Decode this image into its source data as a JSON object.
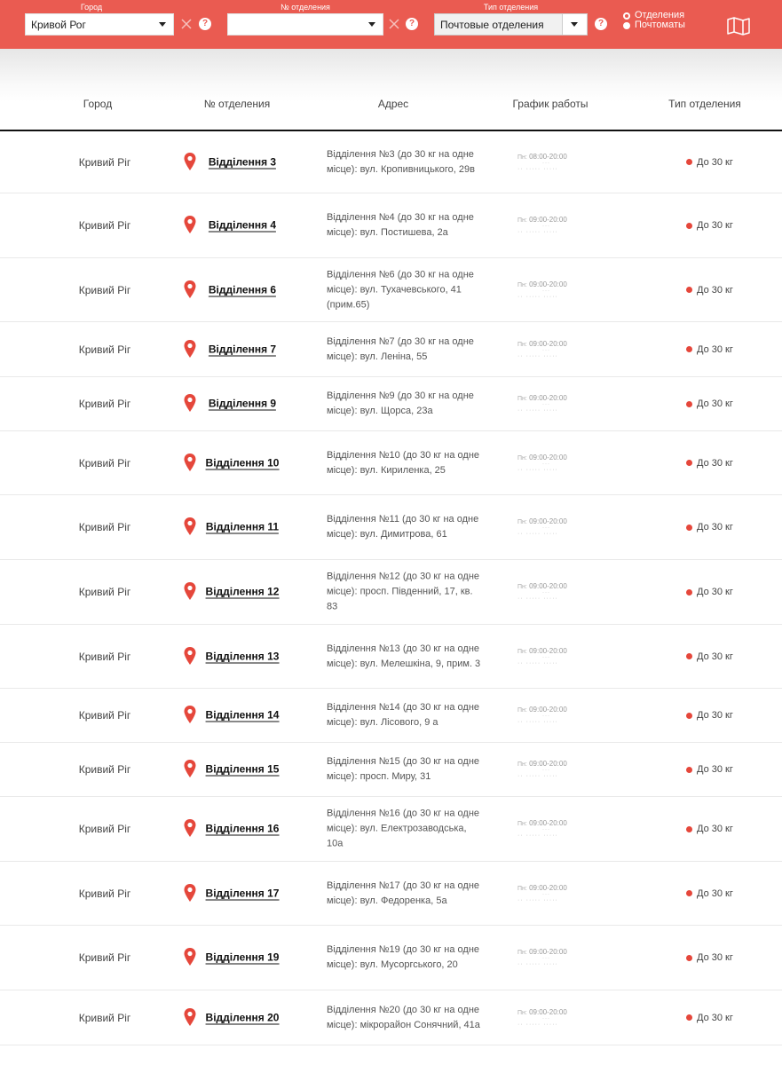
{
  "colors": {
    "accent": "#ea5b51",
    "pin": "#e5473b"
  },
  "filters": {
    "city_label": "Город",
    "city_value": "Кривой Рог",
    "branch_label": "№ отделения",
    "branch_value": "",
    "type_label": "Тип отделения",
    "type_value": "Почтовые отделения",
    "help": "?",
    "radio_branches": "Отделения",
    "radio_lockers": "Почтоматы",
    "selected_radio": "Отделения"
  },
  "table": {
    "headers": {
      "city": "Город",
      "branch": "№ отделения",
      "address": "Адрес",
      "schedule": "График работы",
      "type": "Тип отделения"
    },
    "rows": [
      {
        "city": "Кривий Ріг",
        "branch": "Відділення 3",
        "address": "Відділення №3 (до 30 кг на одне місце): вул. Кропивницького, 29в",
        "day": "Пн:",
        "hours": "08:00-20:00",
        "type": "До 30 кг"
      },
      {
        "city": "Кривий Ріг",
        "branch": "Відділення 4",
        "address": "Відділення №4 (до 30 кг на одне місце): вул. Постишева, 2а",
        "day": "Пн:",
        "hours": "09:00-20:00",
        "type": "До 30 кг"
      },
      {
        "city": "Кривий Ріг",
        "branch": "Відділення 6",
        "address": "Відділення №6 (до 30 кг на одне місце): вул. Тухачевського, 41 (прим.65)",
        "day": "Пн:",
        "hours": "09:00-20:00",
        "type": "До 30 кг"
      },
      {
        "city": "Кривий Ріг",
        "branch": "Відділення 7",
        "address": "Відділення №7 (до 30 кг на одне місце): вул. Леніна, 55",
        "day": "Пн:",
        "hours": "09:00-20:00",
        "type": "До 30 кг"
      },
      {
        "city": "Кривий Ріг",
        "branch": "Відділення 9",
        "address": "Відділення №9 (до 30 кг на одне місце): вул. Щорса, 23а",
        "day": "Пн:",
        "hours": "09:00-20:00",
        "type": "До 30 кг"
      },
      {
        "city": "Кривий Ріг",
        "branch": "Відділення 10",
        "address": "Відділення №10 (до 30 кг на одне місце): вул. Кириленка, 25",
        "day": "Пн:",
        "hours": "09:00-20:00",
        "type": "До 30 кг"
      },
      {
        "city": "Кривий Ріг",
        "branch": "Відділення 11",
        "address": "Відділення №11 (до 30 кг на одне місце): вул. Димитрова, 61",
        "day": "Пн:",
        "hours": "09:00-20:00",
        "type": "До 30 кг"
      },
      {
        "city": "Кривий Ріг",
        "branch": "Відділення 12",
        "address": "Відділення №12 (до 30 кг на одне місце): просп. Південний, 17, кв. 83",
        "day": "Пн:",
        "hours": "09:00-20:00",
        "type": "До 30 кг"
      },
      {
        "city": "Кривий Ріг",
        "branch": "Відділення 13",
        "address": "Відділення №13 (до 30 кг на одне місце): вул. Мелешкіна, 9, прим. 3",
        "day": "Пн:",
        "hours": "09:00-20:00",
        "type": "До 30 кг"
      },
      {
        "city": "Кривий Ріг",
        "branch": "Відділення 14",
        "address": "Відділення №14 (до 30 кг на одне місце): вул. Лісового, 9 а",
        "day": "Пн:",
        "hours": "09:00-20:00",
        "type": "До 30 кг"
      },
      {
        "city": "Кривий Ріг",
        "branch": "Відділення 15",
        "address": "Відділення №15 (до 30 кг на одне місце): просп. Миру, 31",
        "day": "Пн:",
        "hours": "09:00-20:00",
        "type": "До 30 кг"
      },
      {
        "city": "Кривий Ріг",
        "branch": "Відділення 16",
        "address": "Відділення №16 (до 30 кг на одне місце): вул. Електрозаводська, 10а",
        "day": "Пн:",
        "hours": "09:00-20:00",
        "type": "До 30 кг"
      },
      {
        "city": "Кривий Ріг",
        "branch": "Відділення 17",
        "address": "Відділення №17 (до 30 кг на одне місце): вул. Федоренка, 5а",
        "day": "Пн:",
        "hours": "09:00-20:00",
        "type": "До 30 кг"
      },
      {
        "city": "Кривий Ріг",
        "branch": "Відділення 19",
        "address": "Відділення №19 (до 30 кг на одне місце): вул. Мусоргського, 20",
        "day": "Пн:",
        "hours": "09:00-20:00",
        "type": "До 30 кг"
      },
      {
        "city": "Кривий Ріг",
        "branch": "Відділення 20",
        "address": "Відділення №20 (до 30 кг на одне місце): мікрорайон Сонячний, 41а",
        "day": "Пн:",
        "hours": "09:00-20:00",
        "type": "До 30 кг"
      }
    ]
  }
}
